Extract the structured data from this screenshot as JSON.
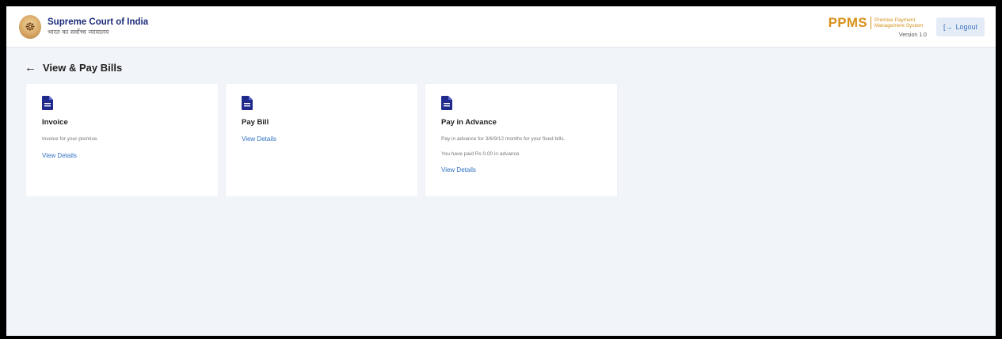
{
  "header": {
    "org_name": "Supreme Court of India",
    "org_subtitle": "भारत का सर्वोच्च न्यायालय",
    "emblem_icon": "court-emblem-icon",
    "app_abbr": "PPMS",
    "app_full_name": "Premise Payment Management System",
    "version": "Version 1.0",
    "logout_label": "Logout",
    "logout_icon": "logout-icon"
  },
  "page": {
    "back_icon": "arrow-left-icon",
    "title": "View & Pay Bills"
  },
  "cards": [
    {
      "icon": "document-icon",
      "title": "Invoice",
      "description": "Invoice for your premise.",
      "link_label": "View Details"
    },
    {
      "icon": "document-icon",
      "title": "Pay Bill",
      "link_label": "View Details"
    },
    {
      "icon": "document-icon",
      "title": "Pay in Advance",
      "description": "Pay in advance for 3/6/9/12 months for your fixed bills.",
      "description2": "You have paid Rs 0.00 in advance.",
      "link_label": "View Details"
    }
  ],
  "colors": {
    "brand_blue": "#1c2a7a",
    "icon_navy": "#1f2a8c",
    "ppms_orange": "#d8901b",
    "link_blue": "#2f72c3",
    "background": "#f1f4f8"
  }
}
